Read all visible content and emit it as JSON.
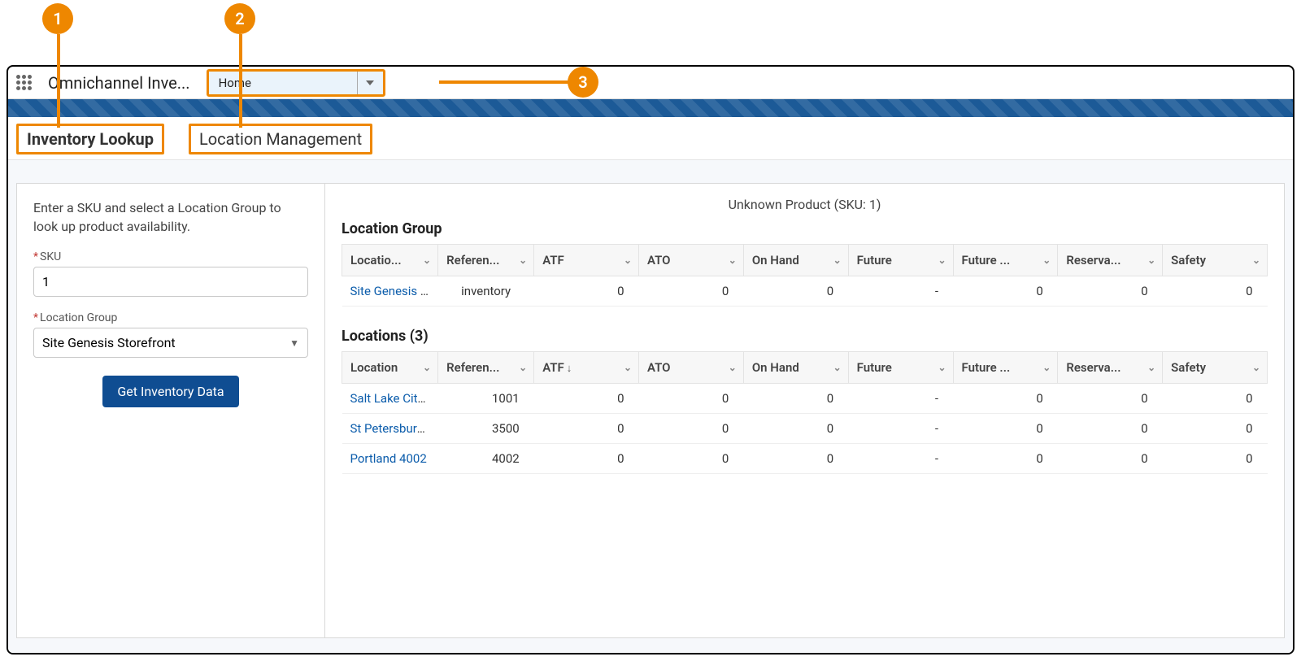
{
  "header": {
    "app_title": "Omnichannel Inve...",
    "nav_selected": "Home"
  },
  "tabs": {
    "inventory_lookup": "Inventory Lookup",
    "location_management": "Location Management"
  },
  "callouts": {
    "one": "1",
    "two": "2",
    "three": "3"
  },
  "left": {
    "instruction": "Enter a SKU and select a Location Group to look up product availability.",
    "sku_label": "SKU",
    "sku_value": "1",
    "lg_label": "Location Group",
    "lg_value": "Site Genesis Storefront",
    "button": "Get Inventory Data"
  },
  "right": {
    "product_title": "Unknown Product (SKU: 1)",
    "section_lg_title": "Location Group",
    "section_loc_title": "Locations (3)",
    "columns": {
      "location_group": "Locatio...",
      "location": "Location",
      "reference": "Referen...",
      "atf": "ATF",
      "ato": "ATO",
      "on_hand": "On Hand",
      "future": "Future",
      "future2": "Future ...",
      "reserved": "Reserva...",
      "safety": "Safety"
    },
    "lg_rows": [
      {
        "name": "Site Genesis ...",
        "ref": "inventory",
        "atf": "0",
        "ato": "0",
        "on_hand": "0",
        "future": "-",
        "future2": "0",
        "reserved": "0",
        "safety": "0"
      }
    ],
    "loc_rows": [
      {
        "name": "Salt Lake City...",
        "ref": "1001",
        "atf": "0",
        "ato": "0",
        "on_hand": "0",
        "future": "-",
        "future2": "0",
        "reserved": "0",
        "safety": "0"
      },
      {
        "name": "St Petersburg...",
        "ref": "3500",
        "atf": "0",
        "ato": "0",
        "on_hand": "0",
        "future": "-",
        "future2": "0",
        "reserved": "0",
        "safety": "0"
      },
      {
        "name": "Portland 4002",
        "ref": "4002",
        "atf": "0",
        "ato": "0",
        "on_hand": "0",
        "future": "-",
        "future2": "0",
        "reserved": "0",
        "safety": "0"
      }
    ]
  }
}
